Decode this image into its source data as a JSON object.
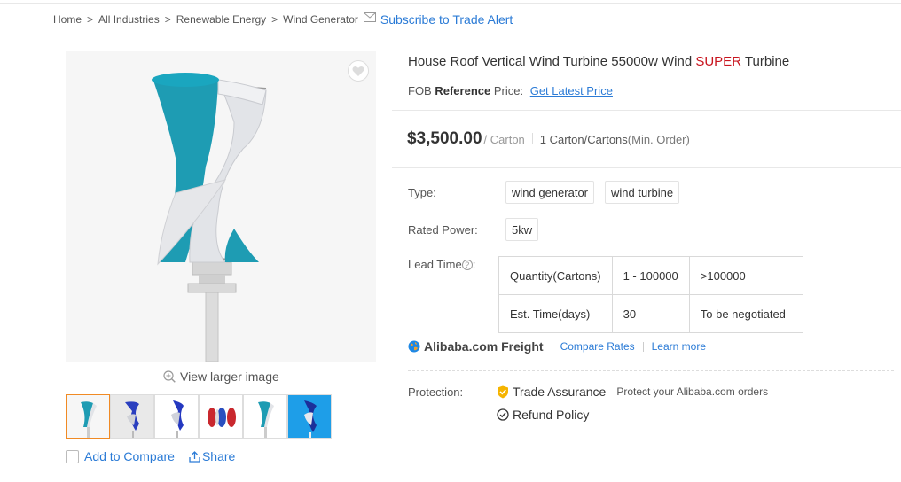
{
  "breadcrumb": {
    "items": [
      "Home",
      "All Industries",
      "Renewable Energy",
      "Wind Generator"
    ],
    "separator": ">",
    "subscribe": "Subscribe to Trade Alert"
  },
  "gallery": {
    "view_larger": "View larger image",
    "thumbnail_count": 6,
    "active_thumbnail": 1,
    "add_to_compare": "Add to Compare",
    "share": "Share"
  },
  "product": {
    "title_main": "House Roof Vertical Wind Turbine 55000w Wind",
    "title_super": "SUPER",
    "title_tail": "Turbine",
    "fob_prefix": "FOB",
    "fob_reference": "Reference",
    "fob_price_label": "Price:",
    "latest_price_link": "Get Latest Price",
    "price": "$3,500.00",
    "price_unit": "/ Carton",
    "moq": "1 Carton/Cartons",
    "moq_note": "(Min. Order)"
  },
  "attributes": {
    "type_label": "Type:",
    "type_values": [
      "wind generator",
      "wind turbine"
    ],
    "rated_power_label": "Rated Power:",
    "rated_power_value": "5kw",
    "lead_time_label": "Lead Time",
    "lead_time_help": "?",
    "lead_table": {
      "rows": [
        [
          "Quantity(Cartons)",
          "1 - 100000",
          ">100000"
        ],
        [
          "Est. Time(days)",
          "30",
          "To be negotiated"
        ]
      ]
    }
  },
  "freight": {
    "brand": "Alibaba.com Freight",
    "compare_rates": "Compare Rates",
    "learn_more": "Learn more"
  },
  "protection": {
    "label": "Protection:",
    "trade_assurance": "Trade Assurance",
    "trade_assurance_desc": "Protect your Alibaba.com orders",
    "refund_policy": "Refund Policy"
  },
  "colors": {
    "link": "#2b7bd6",
    "super": "#c8141e",
    "turbine_teal": "#1e9cb3",
    "active_thumb_border": "#f08a24"
  }
}
